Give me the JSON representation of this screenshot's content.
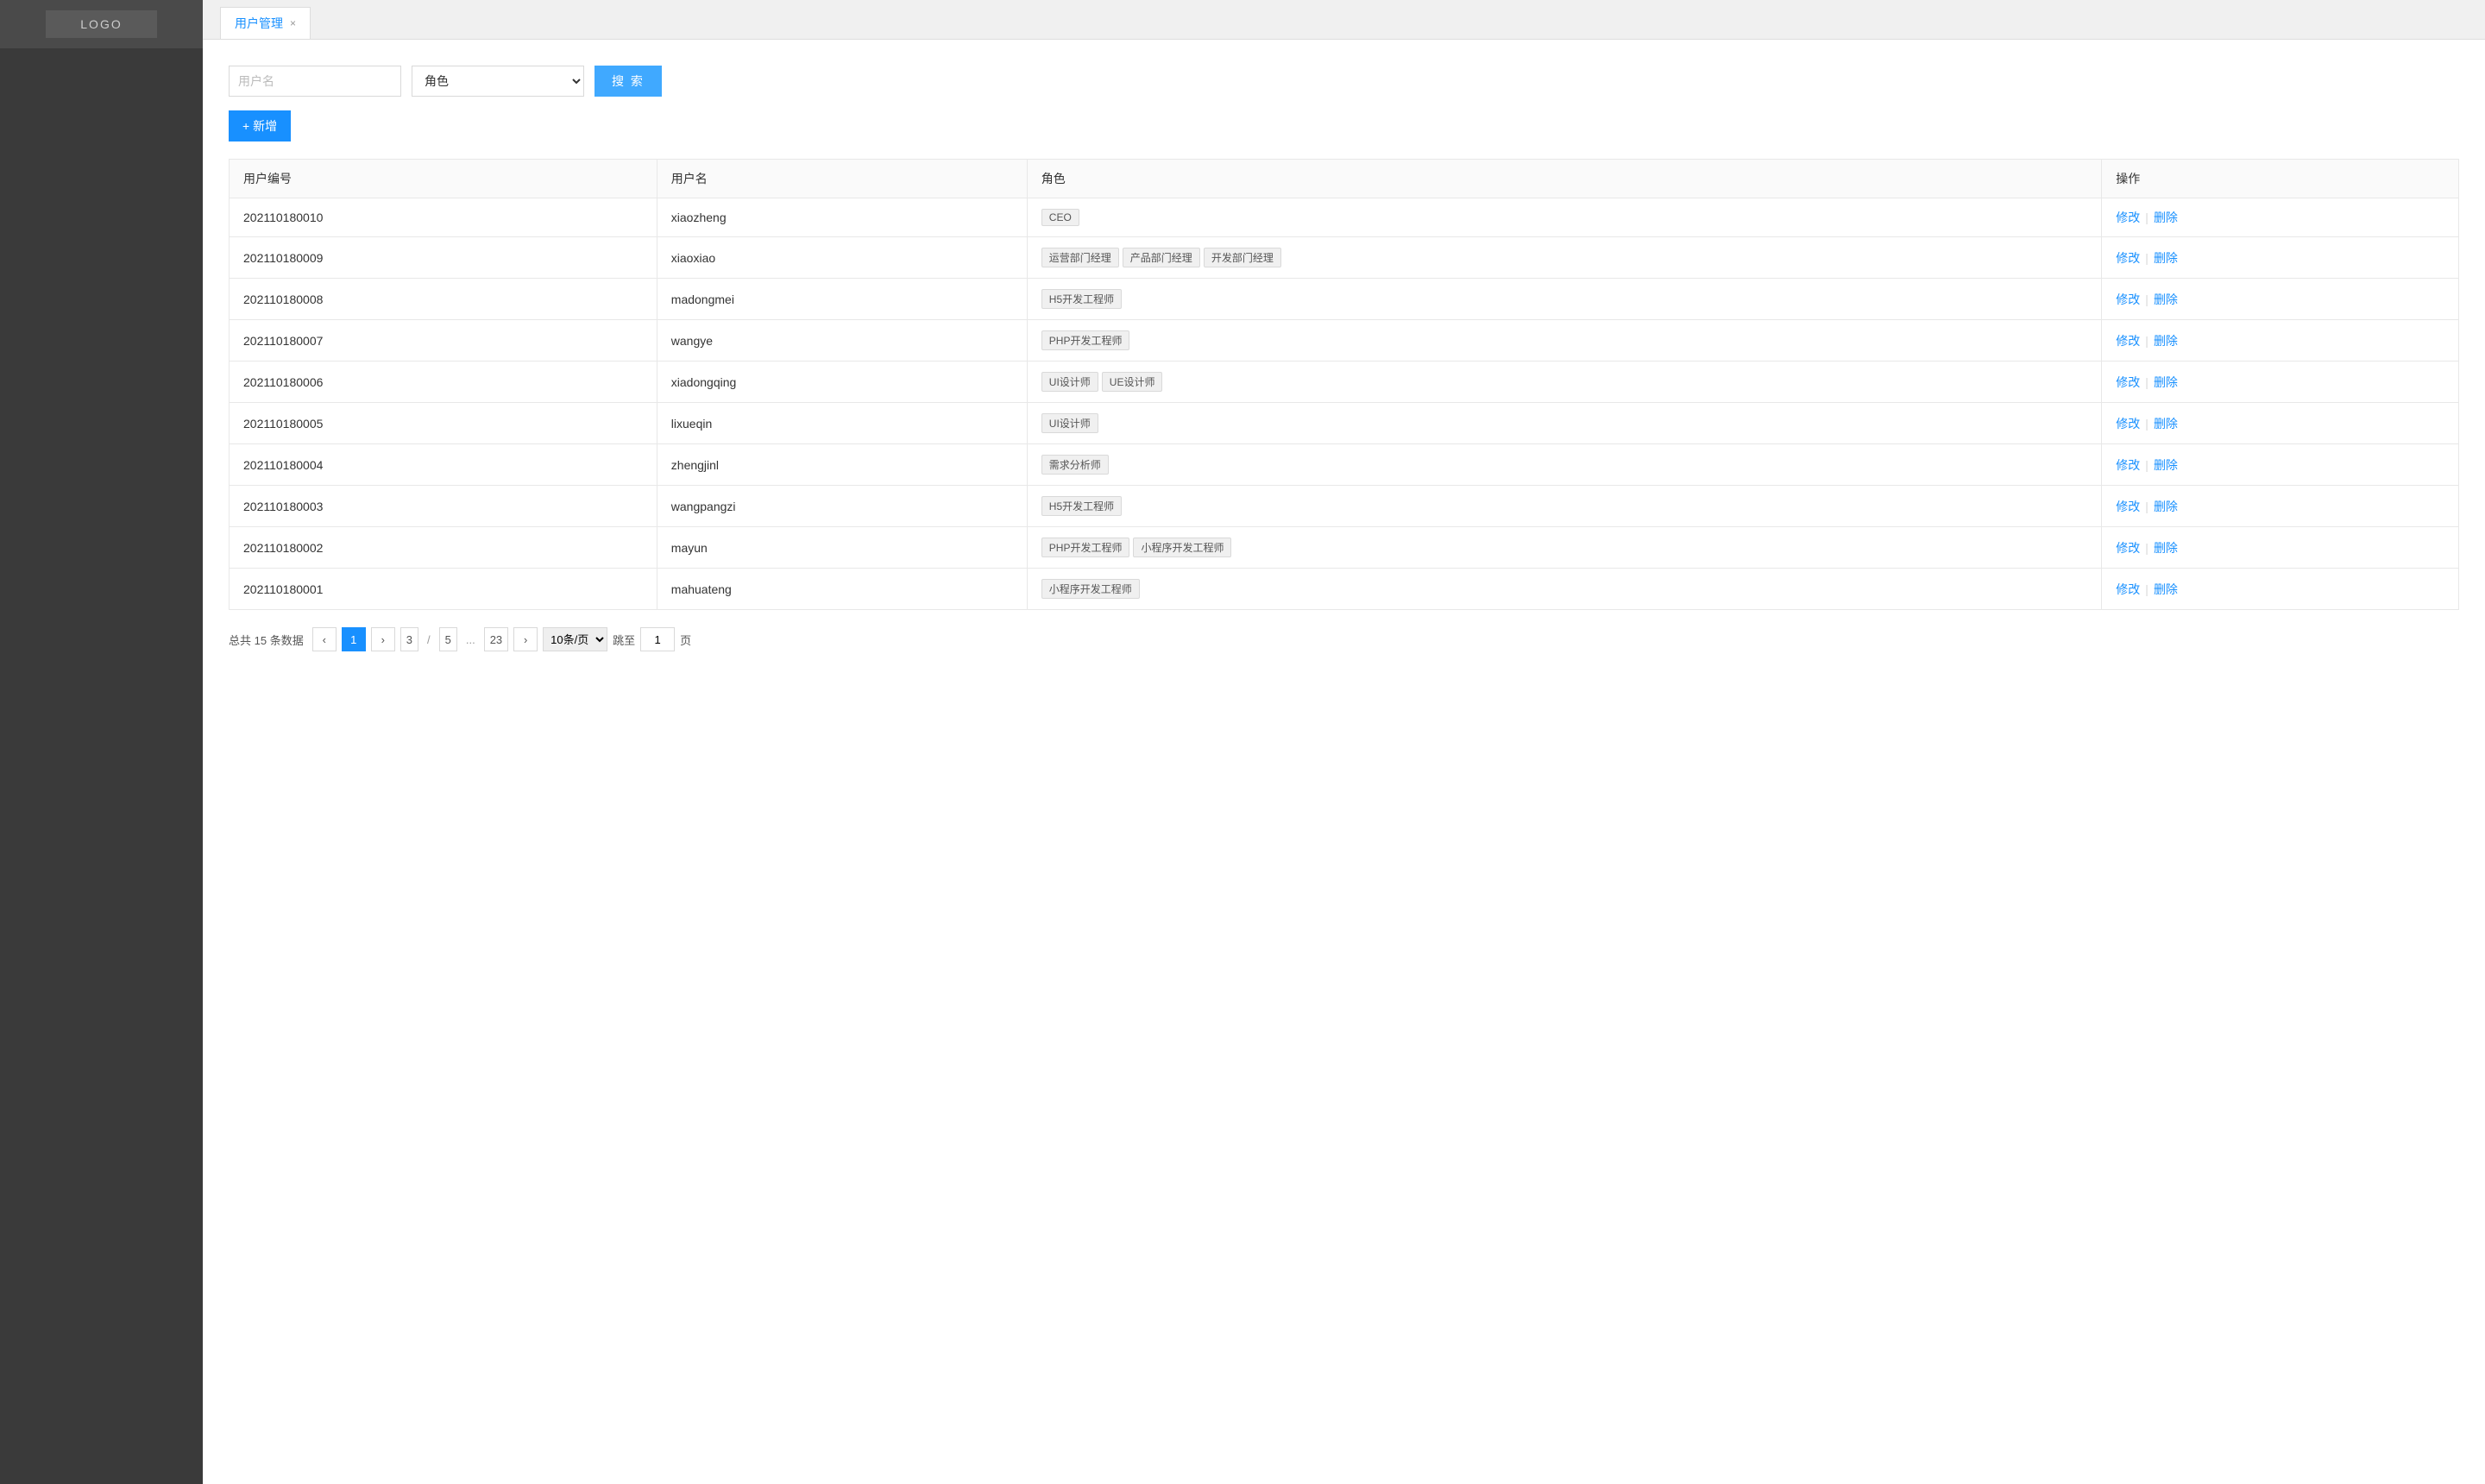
{
  "sidebar": {
    "logo": "LOGO"
  },
  "tab": {
    "label": "用户管理",
    "close": "×"
  },
  "search": {
    "username_placeholder": "用户名",
    "role_placeholder": "角色",
    "button": "搜 索"
  },
  "add_button": "+ 新增",
  "table": {
    "headers": [
      "用户编号",
      "用户名",
      "角色",
      "操作"
    ],
    "rows": [
      {
        "id": "202110180010",
        "username": "xiaozheng",
        "roles": [
          "CEO"
        ],
        "edit": "修改",
        "sep": "|",
        "del": "删除"
      },
      {
        "id": "202110180009",
        "username": "xiaoxiao",
        "roles": [
          "运营部门经理",
          "产品部门经理",
          "开发部门经理"
        ],
        "edit": "修改",
        "sep": "|",
        "del": "删除"
      },
      {
        "id": "202110180008",
        "username": "madongmei",
        "roles": [
          "H5开发工程师"
        ],
        "edit": "修改",
        "sep": "|",
        "del": "删除"
      },
      {
        "id": "202110180007",
        "username": "wangye",
        "roles": [
          "PHP开发工程师"
        ],
        "edit": "修改",
        "sep": "|",
        "del": "删除"
      },
      {
        "id": "202110180006",
        "username": "xiadongqing",
        "roles": [
          "UI设计师",
          "UE设计师"
        ],
        "edit": "修改",
        "sep": "|",
        "del": "删除"
      },
      {
        "id": "202110180005",
        "username": "lixueqin",
        "roles": [
          "UI设计师"
        ],
        "edit": "修改",
        "sep": "|",
        "del": "删除"
      },
      {
        "id": "202110180004",
        "username": "zhengjinl",
        "roles": [
          "需求分析师"
        ],
        "edit": "修改",
        "sep": "|",
        "del": "删除"
      },
      {
        "id": "202110180003",
        "username": "wangpangzi",
        "roles": [
          "H5开发工程师"
        ],
        "edit": "修改",
        "sep": "|",
        "del": "删除"
      },
      {
        "id": "202110180002",
        "username": "mayun",
        "roles": [
          "PHP开发工程师",
          "小程序开发工程师"
        ],
        "edit": "修改",
        "sep": "|",
        "del": "删除"
      },
      {
        "id": "202110180001",
        "username": "mahuateng",
        "roles": [
          "小程序开发工程师"
        ],
        "edit": "修改",
        "sep": "|",
        "del": "删除"
      }
    ]
  },
  "pagination": {
    "total_text": "总共",
    "total_count": "15",
    "total_unit": "条数据",
    "prev": "‹",
    "next": "›",
    "current": "1",
    "page3": "3",
    "slash": "/",
    "page5": "5",
    "dots": "...",
    "last": "23",
    "per_page": "10条/页",
    "goto_label": "跳至",
    "goto_input": "1",
    "goto_suffix": "页"
  }
}
